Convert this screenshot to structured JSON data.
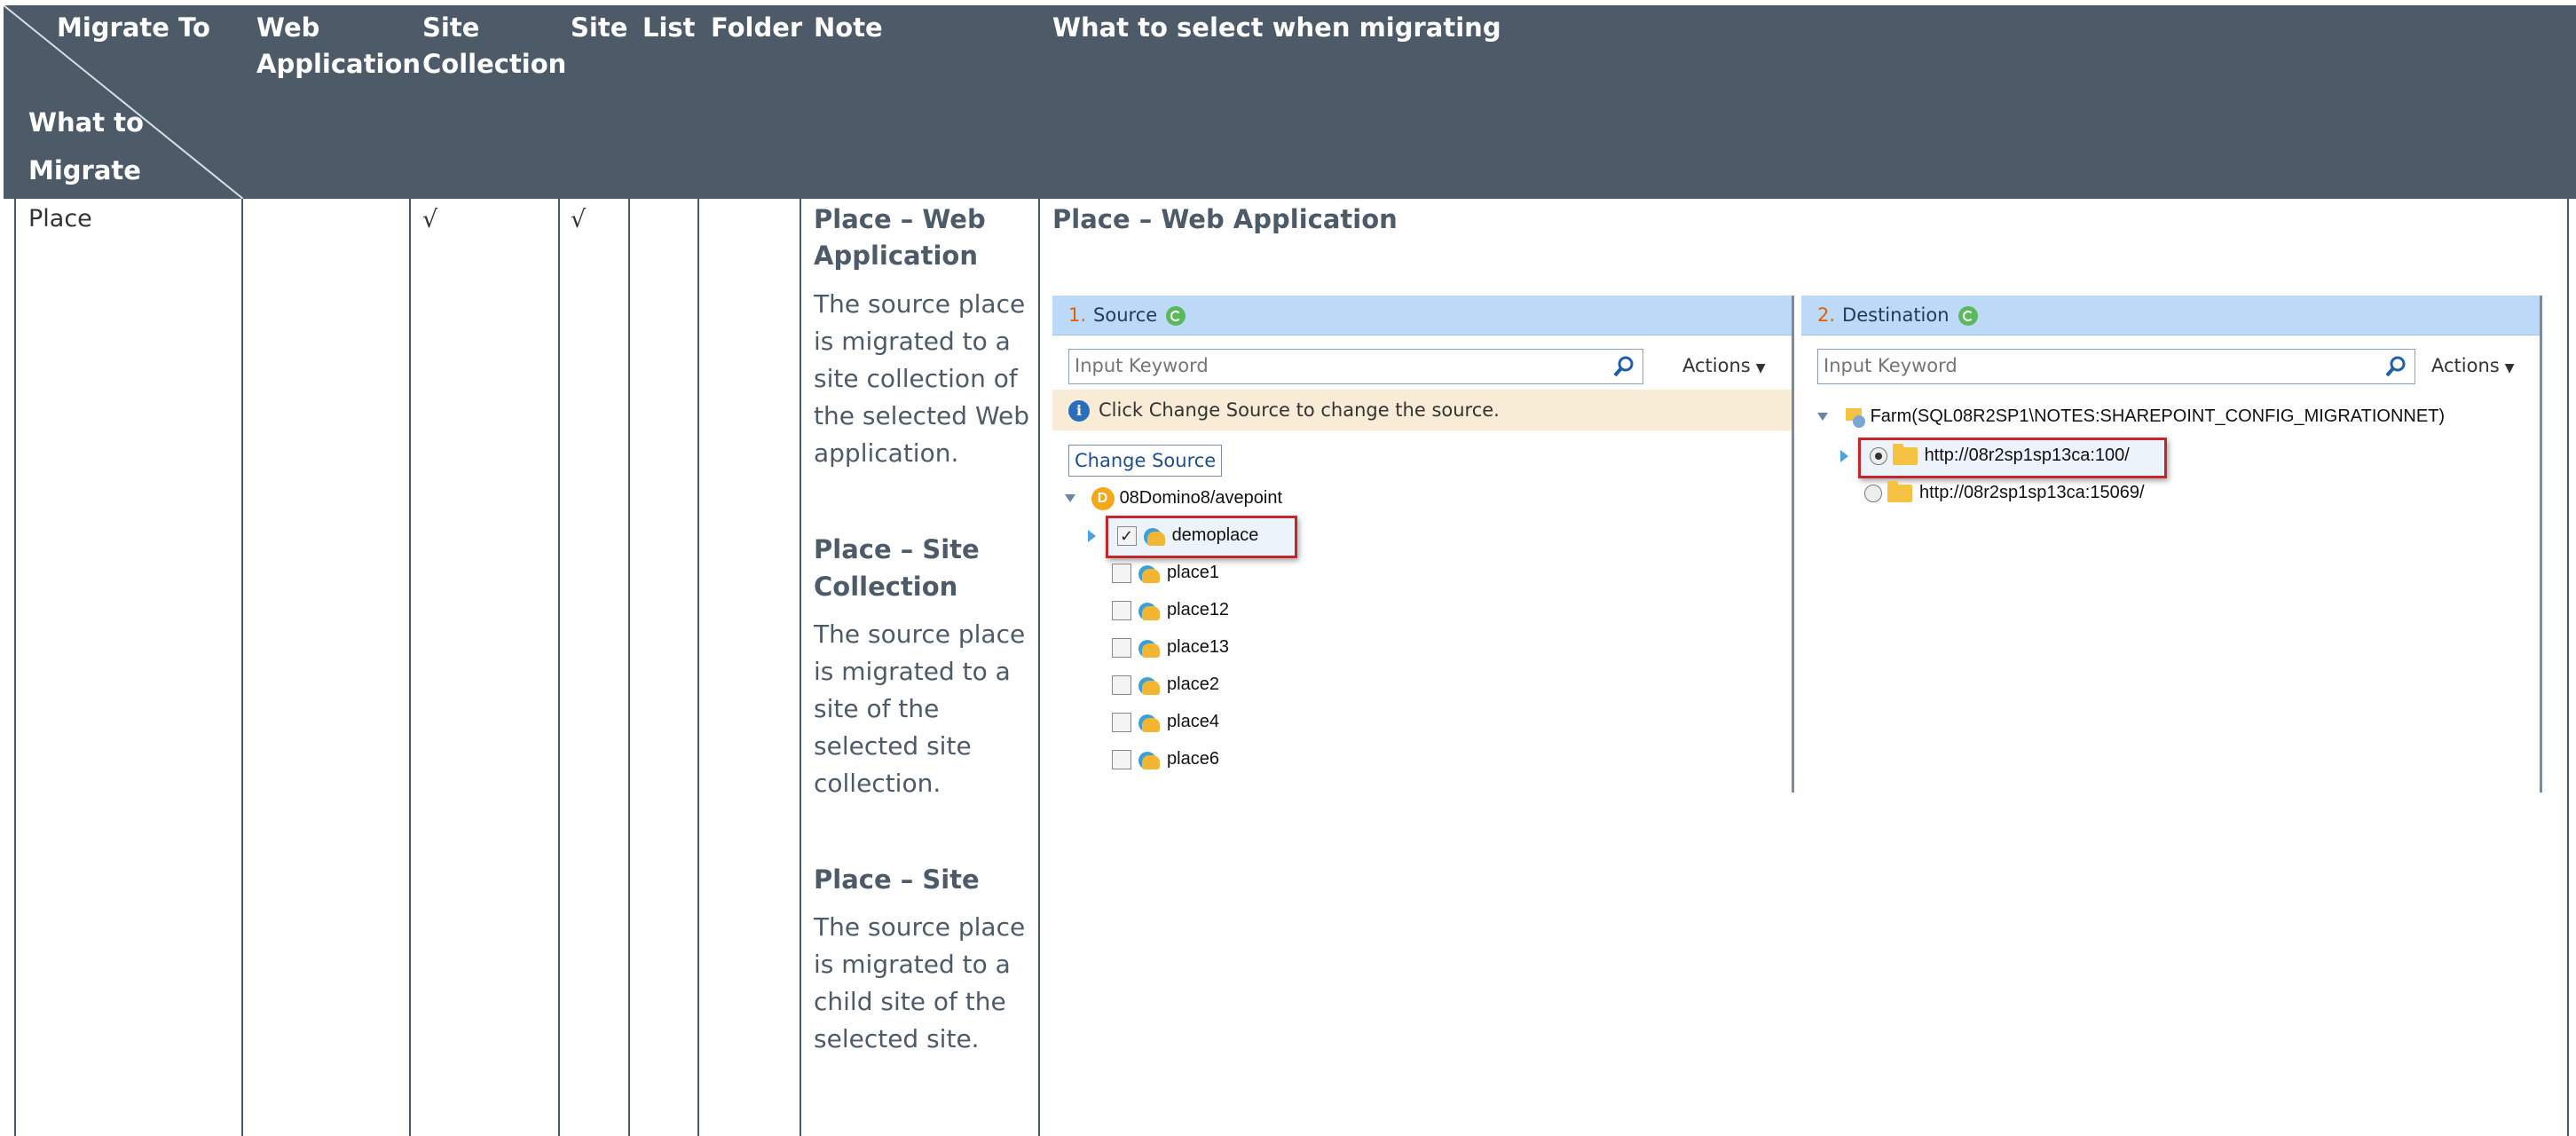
{
  "header": {
    "migrate_to": "Migrate To",
    "what_to": "What to",
    "migrate": "Migrate",
    "web_application_1": "Web",
    "web_application_2": "Application",
    "site_collection_1": "Site",
    "site_collection_2": "Collection",
    "site": "Site",
    "list": "List",
    "folder": "Folder",
    "note": "Note",
    "what_to_select": "What to select when migrating"
  },
  "row": {
    "what_to_migrate": "Place",
    "site_collection_check": "√",
    "site_check": "√"
  },
  "notes": [
    {
      "heading_1": "Place – Web",
      "heading_2": "Application",
      "body": [
        "The source place",
        "is migrated to a",
        "site collection of",
        "the selected Web",
        "application."
      ]
    },
    {
      "heading_1": "Place – Site",
      "heading_2": "Collection",
      "body": [
        "The source place",
        "is migrated to a",
        "site of the",
        "selected site",
        "collection."
      ]
    },
    {
      "heading_1": "Place – Site",
      "body": [
        "The source place",
        "is migrated to a",
        "child site of the",
        "selected site."
      ]
    }
  ],
  "select_section_title": "Place – Web Application",
  "source_panel": {
    "number": "1.",
    "title": "Source",
    "search_placeholder": "Input Keyword",
    "actions_label": "Actions",
    "info_text": "Click Change Source to change the source.",
    "change_source_label": "Change Source",
    "root": "08Domino8/avepoint",
    "items": [
      {
        "label": "demoplace",
        "checked": true
      },
      {
        "label": "place1",
        "checked": false
      },
      {
        "label": "place12",
        "checked": false
      },
      {
        "label": "place13",
        "checked": false
      },
      {
        "label": "place2",
        "checked": false
      },
      {
        "label": "place4",
        "checked": false
      },
      {
        "label": "place6",
        "checked": false
      }
    ]
  },
  "destination_panel": {
    "number": "2.",
    "title": "Destination",
    "search_placeholder": "Input Keyword",
    "actions_label": "Actions",
    "root": "Farm(SQL08R2SP1\\NOTES:SHAREPOINT_CONFIG_MIGRATIONNET)",
    "items": [
      {
        "label": "http://08r2sp1sp13ca:100/",
        "selected": true
      },
      {
        "label": "http://08r2sp1sp13ca:15069/",
        "selected": false
      }
    ]
  },
  "colors": {
    "header_bg": "#4d5b69",
    "header_text": "#ffffff",
    "panel_header": "#bcd9f7",
    "highlight_border": "#c0282b"
  }
}
